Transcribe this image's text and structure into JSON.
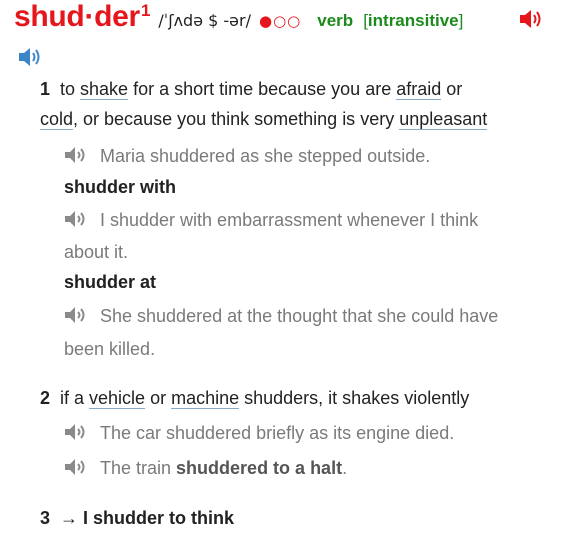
{
  "header": {
    "headword": "shud·der",
    "homograph_number": "1",
    "pronunciation": "/ˈʃʌdə $ -ər/",
    "frequency_filled": "●",
    "frequency_empty": "○○",
    "part_of_speech": "verb",
    "grammar_open": "[",
    "grammar": "intransitive",
    "grammar_close": "]",
    "colors": {
      "headword": "#e6161d",
      "pos": "#1c8a1c",
      "speaker_red": "#e6161d",
      "speaker_blue": "#3a86c8",
      "speaker_grey": "#8a8a8a"
    }
  },
  "senses": [
    {
      "number": "1",
      "definition_parts": [
        "to ",
        "shake",
        " for a short time because you are ",
        "afraid",
        " or"
      ],
      "definition_line2": [
        "cold",
        ", or because you think something is very ",
        "unpleasant"
      ],
      "examples": [
        {
          "text": "Maria shuddered as she stepped outside."
        }
      ],
      "collocations": [
        {
          "phrase": "shudder with",
          "example_line1": "I shudder with embarrassment whenever I think",
          "example_line2": "about it."
        },
        {
          "phrase": "shudder at",
          "example_line1": "She shuddered at the thought that she could have",
          "example_line2": "been killed."
        }
      ]
    },
    {
      "number": "2",
      "definition_parts": [
        "if a ",
        "vehicle",
        " or ",
        "machine",
        " shudders, it shakes violently"
      ],
      "examples": [
        {
          "text": "The car shuddered briefly as its engine died."
        },
        {
          "text_before": "The train ",
          "text_bold": "shuddered to a halt",
          "text_after": "."
        }
      ]
    },
    {
      "number": "3",
      "arrow": "→",
      "cross_reference": "I shudder to think"
    }
  ]
}
